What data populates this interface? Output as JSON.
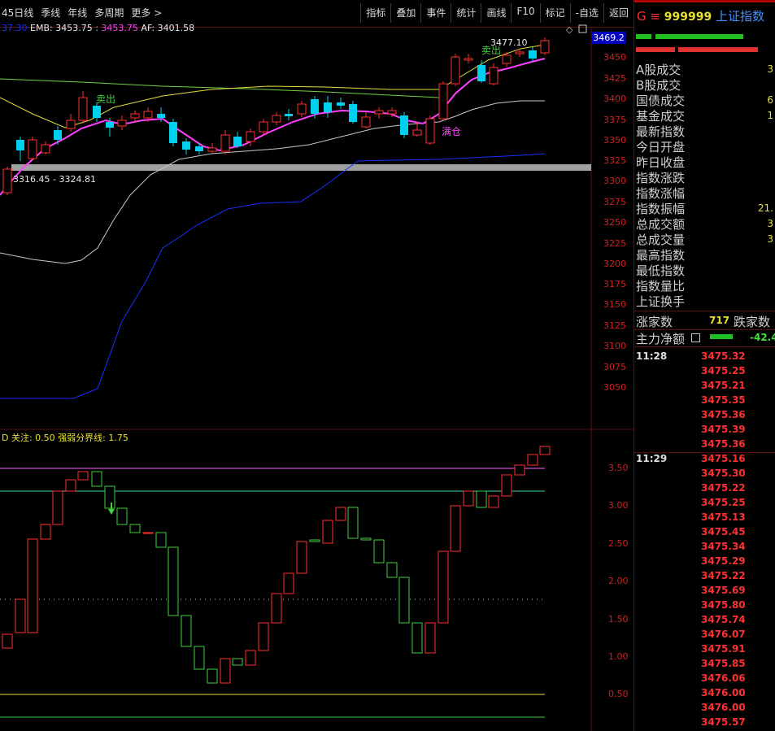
{
  "toolbar": {
    "left_items": [
      "45日线",
      "季线",
      "年线",
      "多周期",
      "更多 >"
    ],
    "right_items": [
      "指标",
      "叠加",
      "事件",
      "统计",
      "画线",
      "F10",
      "标记",
      "-自选",
      "返回"
    ]
  },
  "main_legend": {
    "m1": "37.30",
    "emb_label": "EMB:",
    "emb_value": "3453.75",
    "m3": "3453.75",
    "af_label": "AF:",
    "af_value": "3401.58"
  },
  "price_box": "3469.2",
  "annotations": {
    "high_label": "3477.10",
    "sell1": "卖出",
    "sell2": "卖出",
    "full": "满仓",
    "range": "3316.45 - 3324.81"
  },
  "price_axis": [
    "3450",
    "3425",
    "3400",
    "3375",
    "3350",
    "3325",
    "3300",
    "3275",
    "3250",
    "3225",
    "3200",
    "3175",
    "3150",
    "3125",
    "3100",
    "3075",
    "3050"
  ],
  "ind_legend": {
    "prefix": "D",
    "label1": "关注: 0.50",
    "label2": "强弱分界线: 1.75"
  },
  "ind_axis": [
    "3.50",
    "3.00",
    "2.50",
    "2.00",
    "1.50",
    "1.00",
    "0.50"
  ],
  "right_panel": {
    "code_prefix": "G ≡",
    "code": "999999",
    "name": "上证指数",
    "rows": [
      {
        "label": "A股成交",
        "value": "3"
      },
      {
        "label": "B股成交",
        "value": ""
      },
      {
        "label": "国债成交",
        "value": "6"
      },
      {
        "label": "基金成交",
        "value": "1"
      },
      {
        "label": "最新指数",
        "value": ""
      },
      {
        "label": "今日开盘",
        "value": ""
      },
      {
        "label": "昨日收盘",
        "value": ""
      },
      {
        "label": "指数涨跌",
        "value": ""
      },
      {
        "label": "指数涨幅",
        "value": ""
      },
      {
        "label": "指数振幅",
        "value": "21."
      },
      {
        "label": "总成交额",
        "value": "3"
      },
      {
        "label": "总成交量",
        "value": "3"
      },
      {
        "label": "最高指数",
        "value": ""
      },
      {
        "label": "最低指数",
        "value": ""
      },
      {
        "label": "指数量比",
        "value": ""
      },
      {
        "label": "上证换手",
        "value": ""
      }
    ],
    "up_label": "涨家数",
    "up_value": "717",
    "down_label": "跌家数",
    "main_flow_label": "主力净额",
    "main_flow_value": "-42.4",
    "ticks": [
      {
        "time": "11:28",
        "values": [
          "3475.32",
          "3475.25",
          "3475.21",
          "3475.35",
          "3475.36",
          "3475.39",
          "3475.36"
        ]
      },
      {
        "time": "11:29",
        "values": [
          "3475.16",
          "3475.30",
          "3475.22",
          "3475.25",
          "3475.13",
          "3475.45",
          "3475.34",
          "3475.29",
          "3475.22",
          "3475.69",
          "3475.80",
          "3475.74",
          "3476.07",
          "3475.91",
          "3475.85",
          "3476.06",
          "3476.00",
          "3476.00",
          "3475.57"
        ]
      }
    ]
  },
  "colors": {
    "up": "#ff3030",
    "down": "#00d0f0",
    "ma_yellow": "#e0e040",
    "ma_magenta": "#ff40ff",
    "ma_white": "#c8c8c8",
    "ma_blue": "#1830ff",
    "ma_green": "#70d040",
    "ind_up": "#ff3030",
    "ind_down": "#40d040"
  }
}
